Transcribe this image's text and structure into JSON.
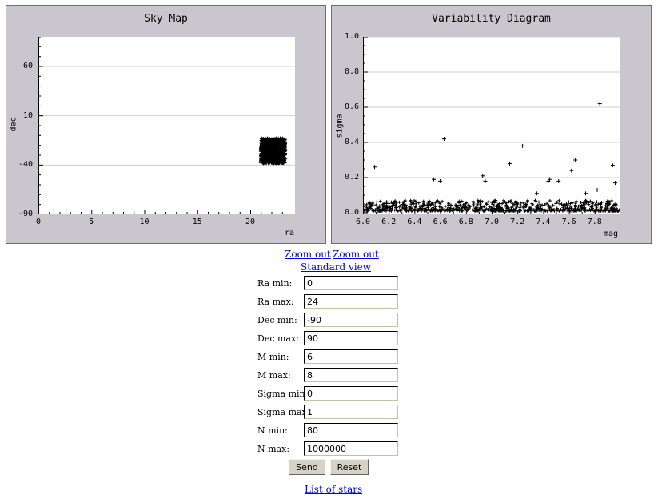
{
  "sky_map": {
    "title": "Sky Map",
    "xlabel": "ra",
    "ylabel": "dec"
  },
  "variability": {
    "title": "Variability Diagram",
    "xlabel": "mag",
    "ylabel": "sigma"
  },
  "links": {
    "zoom_out_1": "Zoom out",
    "zoom_out_2": "Zoom out",
    "standard_view": "Standard view",
    "list_of_stars": "List of stars"
  },
  "form": {
    "fields": [
      {
        "label": "Ra min:",
        "value": "0"
      },
      {
        "label": "Ra max:",
        "value": "24"
      },
      {
        "label": "Dec min:",
        "value": "-90"
      },
      {
        "label": "Dec max:",
        "value": "90"
      },
      {
        "label": "M min:",
        "value": "6"
      },
      {
        "label": "M max:",
        "value": "8"
      },
      {
        "label": "Sigma min:",
        "value": "0"
      },
      {
        "label": "Sigma max:",
        "value": "1"
      },
      {
        "label": "N min:",
        "value": "80"
      },
      {
        "label": "N max:",
        "value": "1000000"
      }
    ],
    "send_label": "Send",
    "reset_label": "Reset"
  },
  "chart_data": [
    {
      "type": "scatter",
      "title": "Sky Map",
      "xlabel": "ra",
      "ylabel": "dec",
      "xlim": [
        0,
        24
      ],
      "ylim": [
        -90,
        90
      ],
      "xticks": [
        "0",
        "5",
        "10",
        "15",
        "20"
      ],
      "yticks": [
        "-90",
        "-40",
        "10",
        "60"
      ],
      "grid": true,
      "marker": "+",
      "cluster": {
        "ra_range": [
          21,
          23.3
        ],
        "dec_range": [
          -38,
          -13
        ]
      }
    },
    {
      "type": "scatter",
      "title": "Variability Diagram",
      "xlabel": "mag",
      "ylabel": "sigma",
      "xlim": [
        6.0,
        8.0
      ],
      "ylim": [
        0.0,
        1.0
      ],
      "xticks": [
        "6.0",
        "6.2",
        "6.4",
        "6.6",
        "6.8",
        "7.0",
        "7.2",
        "7.4",
        "7.6",
        "7.8"
      ],
      "yticks": [
        "0.0",
        "0.2",
        "0.4",
        "0.6",
        "0.8",
        "1.0"
      ],
      "grid": true,
      "marker": "+",
      "outliers": [
        {
          "x": 6.09,
          "y": 0.26
        },
        {
          "x": 6.55,
          "y": 0.19
        },
        {
          "x": 6.6,
          "y": 0.18
        },
        {
          "x": 6.63,
          "y": 0.42
        },
        {
          "x": 6.93,
          "y": 0.21
        },
        {
          "x": 6.95,
          "y": 0.18
        },
        {
          "x": 7.14,
          "y": 0.28
        },
        {
          "x": 7.24,
          "y": 0.38
        },
        {
          "x": 7.35,
          "y": 0.11
        },
        {
          "x": 7.44,
          "y": 0.18
        },
        {
          "x": 7.45,
          "y": 0.19
        },
        {
          "x": 7.52,
          "y": 0.18
        },
        {
          "x": 7.62,
          "y": 0.24
        },
        {
          "x": 7.65,
          "y": 0.3
        },
        {
          "x": 7.84,
          "y": 0.62
        },
        {
          "x": 7.94,
          "y": 0.27
        },
        {
          "x": 7.96,
          "y": 0.17
        },
        {
          "x": 7.73,
          "y": 0.11
        },
        {
          "x": 7.82,
          "y": 0.13
        }
      ],
      "baseline_sigma_range": [
        0.0,
        0.06
      ]
    }
  ]
}
